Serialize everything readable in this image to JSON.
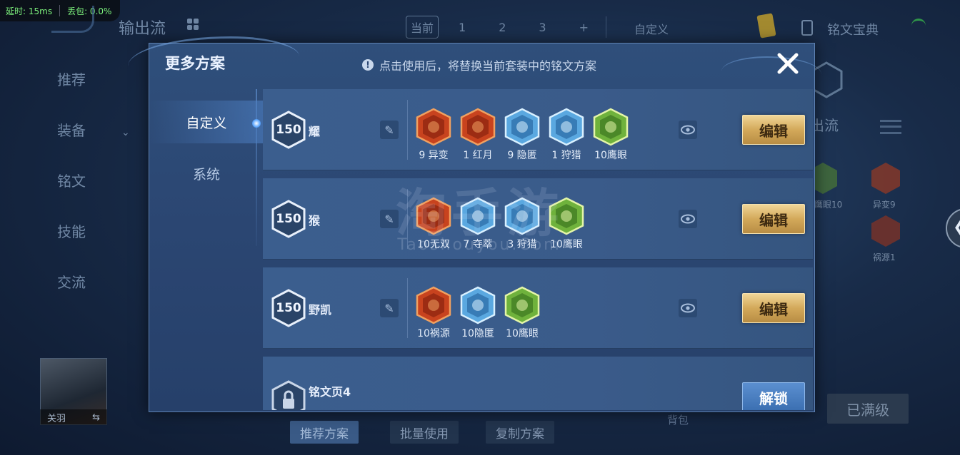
{
  "net": {
    "latency": "延时: 15ms",
    "loss": "丢包: 0.0%"
  },
  "bg": {
    "title": "输出流",
    "tabs": {
      "current": "当前",
      "n1": "1",
      "n2": "2",
      "n3": "3",
      "add": "+"
    },
    "custom": "自定义",
    "book": "铭文宝典",
    "side": [
      "推荐",
      "装备",
      "铭文",
      "技能",
      "交流"
    ],
    "hero_name": "关羽",
    "hero_swap": "⇆",
    "bottom_buttons": [
      "推荐方案",
      "批量使用",
      "复制方案"
    ],
    "maxed": "已满级",
    "backpack": "背包",
    "right_label": "出流",
    "right_runes": [
      "鹰眼10",
      "异变9",
      "祸源1"
    ]
  },
  "dialog": {
    "title": "更多方案",
    "tip_icon": "!",
    "tip": "点击使用后，将替换当前套装中的铭文方案",
    "tabs": [
      "自定义",
      "系统"
    ],
    "rows": [
      {
        "level": "150",
        "name": "耀",
        "runes": [
          {
            "label": "9 异变",
            "color": "red"
          },
          {
            "label": "1 红月",
            "color": "red"
          },
          {
            "label": "9 隐匿",
            "color": "blue"
          },
          {
            "label": "1 狩猎",
            "color": "blue"
          },
          {
            "label": "10鹰眼",
            "color": "green"
          }
        ],
        "edit": "编辑"
      },
      {
        "level": "150",
        "name": "猴",
        "runes": [
          {
            "label": "10无双",
            "color": "red"
          },
          {
            "label": "7 夺萃",
            "color": "blue"
          },
          {
            "label": "3 狩猎",
            "color": "blue"
          },
          {
            "label": "10鹰眼",
            "color": "green"
          }
        ],
        "edit": "编辑"
      },
      {
        "level": "150",
        "name": "野凯",
        "runes": [
          {
            "label": "10祸源",
            "color": "red"
          },
          {
            "label": "10隐匿",
            "color": "blue"
          },
          {
            "label": "10鹰眼",
            "color": "green"
          }
        ],
        "edit": "编辑"
      },
      {
        "name": "铭文页4",
        "unlock": "解锁"
      }
    ]
  },
  "watermark": {
    "big": "淘手游",
    "small": "Taoshouyou.Com"
  },
  "colors": {
    "accent_gold": "#d3a95a",
    "panel": "#2b4672",
    "rune_red": "#c8431e",
    "rune_blue": "#5aa8e0",
    "rune_green": "#6fb23c"
  }
}
